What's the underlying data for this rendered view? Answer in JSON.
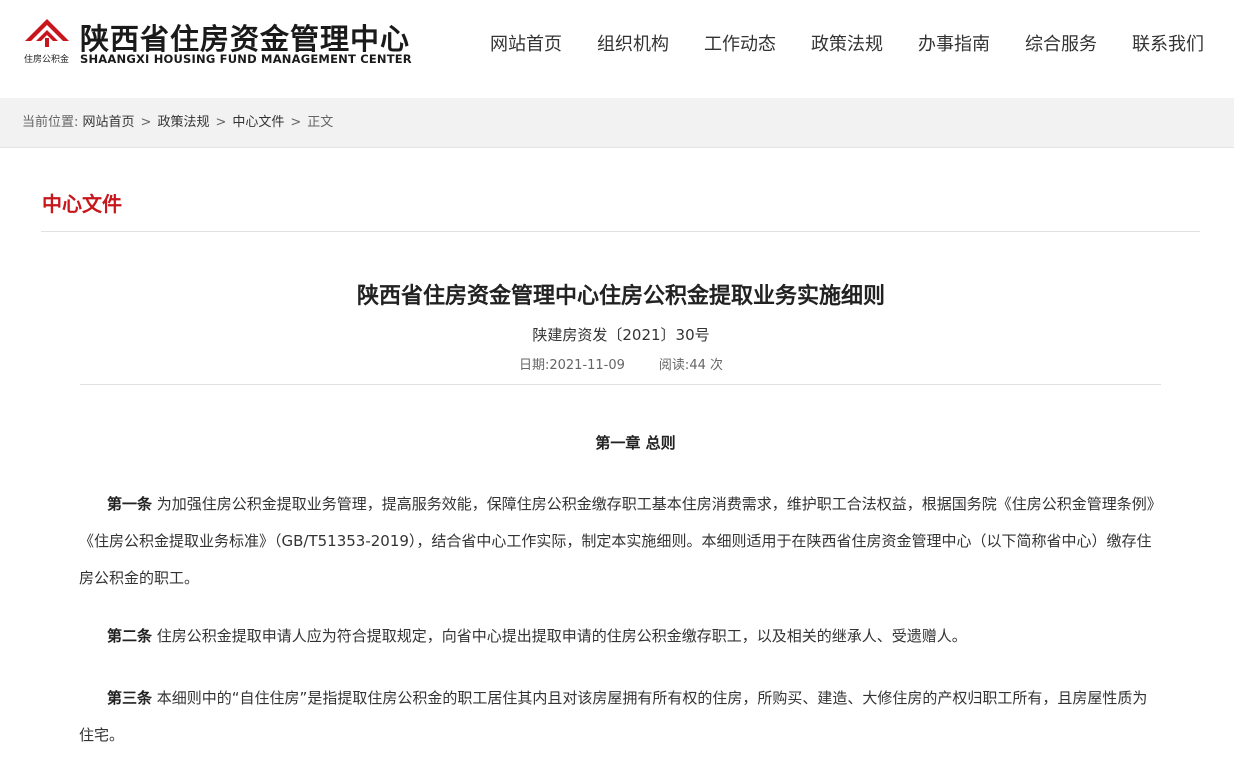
{
  "header": {
    "logo_small_text": "住房公积金",
    "logo_cn": "陕西省住房资金管理中心",
    "logo_en": "SHAANGXI HOUSING FUND MANAGEMENT CENTER",
    "nav": [
      "网站首页",
      "组织机构",
      "工作动态",
      "政策法规",
      "办事指南",
      "综合服务",
      "联系我们"
    ]
  },
  "breadcrumb": {
    "prefix": "当前位置:",
    "items": [
      "网站首页",
      "政策法规",
      "中心文件",
      "正文"
    ],
    "separator": ">"
  },
  "section": {
    "title": "中心文件"
  },
  "article": {
    "title": "陕西省住房资金管理中心住房公积金提取业务实施细则",
    "doc_number": "陕建房资发〔2021〕30号",
    "date_label": "日期:",
    "date": "2021-11-09",
    "views_label": "阅读:",
    "views": "44",
    "views_unit": "次",
    "chapter": "第一章 总则",
    "paragraphs": [
      {
        "lead": "第一条",
        "text": " 为加强住房公积金提取业务管理，提高服务效能，保障住房公积金缴存职工基本住房消费需求，维护职工合法权益，根据国务院《住房公积金管理条例》《住房公积金提取业务标准》（GB/T51353-2019），结合省中心工作实际，制定本实施细则。本细则适用于在陕西省住房资金管理中心（以下简称省中心）缴存住房公积金的职工。"
      },
      {
        "lead": "第二条",
        "text": " 住房公积金提取申请人应为符合提取规定，向省中心提出提取申请的住房公积金缴存职工，以及相关的继承人、受遗赠人。"
      },
      {
        "lead": "第三条",
        "text": " 本细则中的“自住住房”是指提取住房公积金的职工居住其内且对该房屋拥有所有权的住房，所购买、建造、大修住房的产权归职工所有，且房屋性质为住宅。"
      }
    ]
  },
  "colors": {
    "accent": "#c8161d",
    "logo_red": "#c8161d"
  }
}
